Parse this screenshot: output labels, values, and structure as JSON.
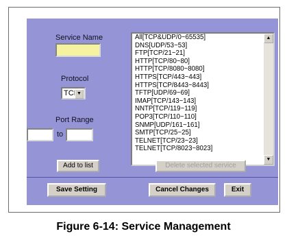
{
  "form": {
    "service_name_label": "Service Name",
    "service_name_value": "",
    "protocol_label": "Protocol",
    "protocol_selected": "TCP",
    "port_range_label": "Port Range",
    "port_from_value": "",
    "port_to_label": "to",
    "port_to_value": ""
  },
  "service_list": {
    "items": [
      "All[TCP&UDP/0~65535]",
      "DNS[UDP/53~53]",
      "FTP[TCP/21~21]",
      "HTTP[TCP/80~80]",
      "HTTP[TCP/8080~8080]",
      "HTTPS[TCP/443~443]",
      "HTTPS[TCP/8443~8443]",
      "TFTP[UDP/69~69]",
      "IMAP[TCP/143~143]",
      "NNTP[TCP/119~119]",
      "POP3[TCP/110~110]",
      "SNMP[UDP/161~161]",
      "SMTP[TCP/25~25]",
      "TELNET[TCP/23~23]",
      "TELNET[TCP/8023~8023]"
    ]
  },
  "buttons": {
    "add_to_list": "Add to list",
    "delete_selected": "Delete selected service",
    "save_setting": "Save Setting",
    "cancel_changes": "Cancel Changes",
    "exit": "Exit"
  },
  "caption": "Figure 6-14: Service Management",
  "colors": {
    "panel_bg": "#9494d6",
    "service_field_bg": "#f6f3a0",
    "button_face": "#d4d0c8"
  }
}
